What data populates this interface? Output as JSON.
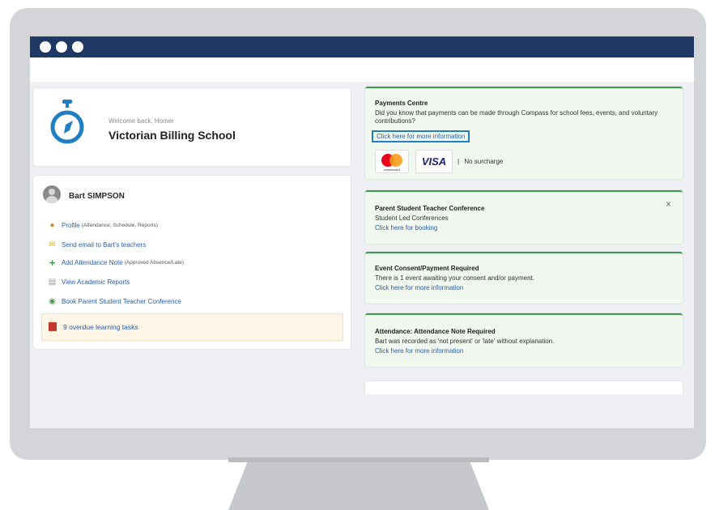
{
  "school": {
    "welcome": "Welcome back, Homer",
    "name": "Victorian Billing School"
  },
  "student": {
    "name": "Bart SIMPSON",
    "links": [
      {
        "icon": "person-icon",
        "label": "Profile",
        "sub": "(Attendance, Schedule, Reports)"
      },
      {
        "icon": "envelope-icon",
        "label": "Send email to Bart's teachers",
        "sub": ""
      },
      {
        "icon": "plus-icon",
        "label": "Add Attendance Note",
        "sub": "(Approved Absence/Late)"
      },
      {
        "icon": "document-icon",
        "label": "View Academic Reports",
        "sub": ""
      },
      {
        "icon": "people-icon",
        "label": "Book Parent Student Teacher Conference",
        "sub": ""
      }
    ],
    "overdue": "9 overdue learning tasks"
  },
  "payments": {
    "title": "Payments Centre",
    "text": "Did you know that payments can be made through Compass for school fees, events, and voluntary contributions?",
    "link": "Click here for more information",
    "mastercard_label": "mastercard",
    "visa_label": "VISA",
    "separator": "|",
    "surcharge": "No surcharge"
  },
  "notices": [
    {
      "title": "Parent Student Teacher Conference",
      "text": "Student Led Conferences",
      "link": "Click here for booking",
      "close": "×"
    },
    {
      "title": "Event Consent/Payment Required",
      "text": "There is 1 event awaiting your consent and/or payment.",
      "link": "Click here for more information"
    },
    {
      "title": "Attendance: Attendance Note Required",
      "text": "Bart was recorded as 'not present' or 'late' without explanation.",
      "link": "Click here for more information"
    }
  ],
  "colors": {
    "titlebar": "#1f3864",
    "notice_accent": "#3d9a4f",
    "link": "#2a5db0",
    "highlight_box": "#1f7fc2"
  }
}
